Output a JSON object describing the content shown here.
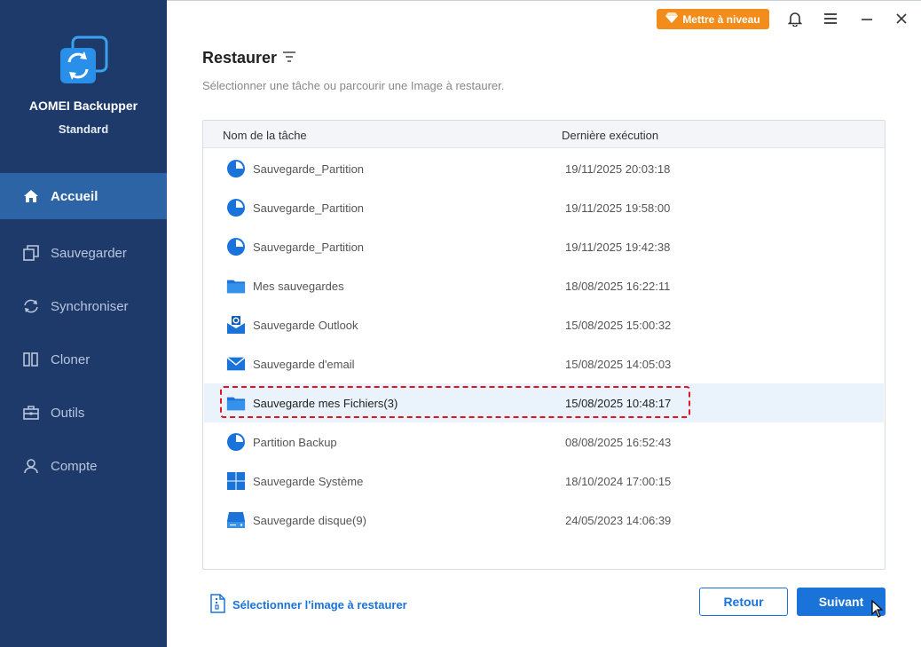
{
  "app": {
    "name": "AOMEI Backupper",
    "edition": "Standard"
  },
  "sidebar": {
    "items": [
      {
        "label": "Accueil",
        "icon": "home-icon",
        "active": true
      },
      {
        "label": "Sauvegarder",
        "icon": "backup-icon",
        "active": false
      },
      {
        "label": "Synchroniser",
        "icon": "sync-icon",
        "active": false
      },
      {
        "label": "Cloner",
        "icon": "clone-icon",
        "active": false
      },
      {
        "label": "Outils",
        "icon": "tools-icon",
        "active": false
      },
      {
        "label": "Compte",
        "icon": "account-icon",
        "active": false
      }
    ]
  },
  "topbar": {
    "upgrade_label": "Mettre à niveau"
  },
  "main": {
    "title": "Restaurer",
    "subtitle": "Sélectionner une tâche ou parcourir une Image à restaurer.",
    "table": {
      "headers": [
        "Nom de la tâche",
        "Dernière exécution"
      ],
      "rows": [
        {
          "name": "Sauvegarde_Partition",
          "date": "19/11/2025 20:03:18",
          "icon": "partition-icon"
        },
        {
          "name": "Sauvegarde_Partition",
          "date": "19/11/2025 19:58:00",
          "icon": "partition-icon"
        },
        {
          "name": "Sauvegarde_Partition",
          "date": "19/11/2025 19:42:38",
          "icon": "partition-icon"
        },
        {
          "name": "Mes sauvegardes",
          "date": "18/08/2025 16:22:11",
          "icon": "folder-icon"
        },
        {
          "name": "Sauvegarde Outlook",
          "date": "15/08/2025 15:00:32",
          "icon": "outlook-icon"
        },
        {
          "name": "Sauvegarde d'email",
          "date": "15/08/2025 14:05:03",
          "icon": "email-icon"
        },
        {
          "name": "Sauvegarde mes Fichiers(3)",
          "date": "15/08/2025 10:48:17",
          "icon": "folder-icon",
          "selected": true
        },
        {
          "name": "Partition Backup",
          "date": "08/08/2025 16:52:43",
          "icon": "partition-icon"
        },
        {
          "name": "Sauvegarde Système",
          "date": "18/10/2024 17:00:15",
          "icon": "windows-icon"
        },
        {
          "name": "Sauvegarde disque(9)",
          "date": "24/05/2023 14:06:39",
          "icon": "disk-icon"
        }
      ]
    },
    "select_image_label": "Sélectionner l'image à restaurer",
    "back_label": "Retour",
    "next_label": "Suivant"
  },
  "colors": {
    "sidebar_bg": "#1d3a6a",
    "sidebar_active": "#2d64a5",
    "accent": "#1a73d9",
    "upgrade": "#f28c1b",
    "highlight_dash": "#e0151f"
  }
}
